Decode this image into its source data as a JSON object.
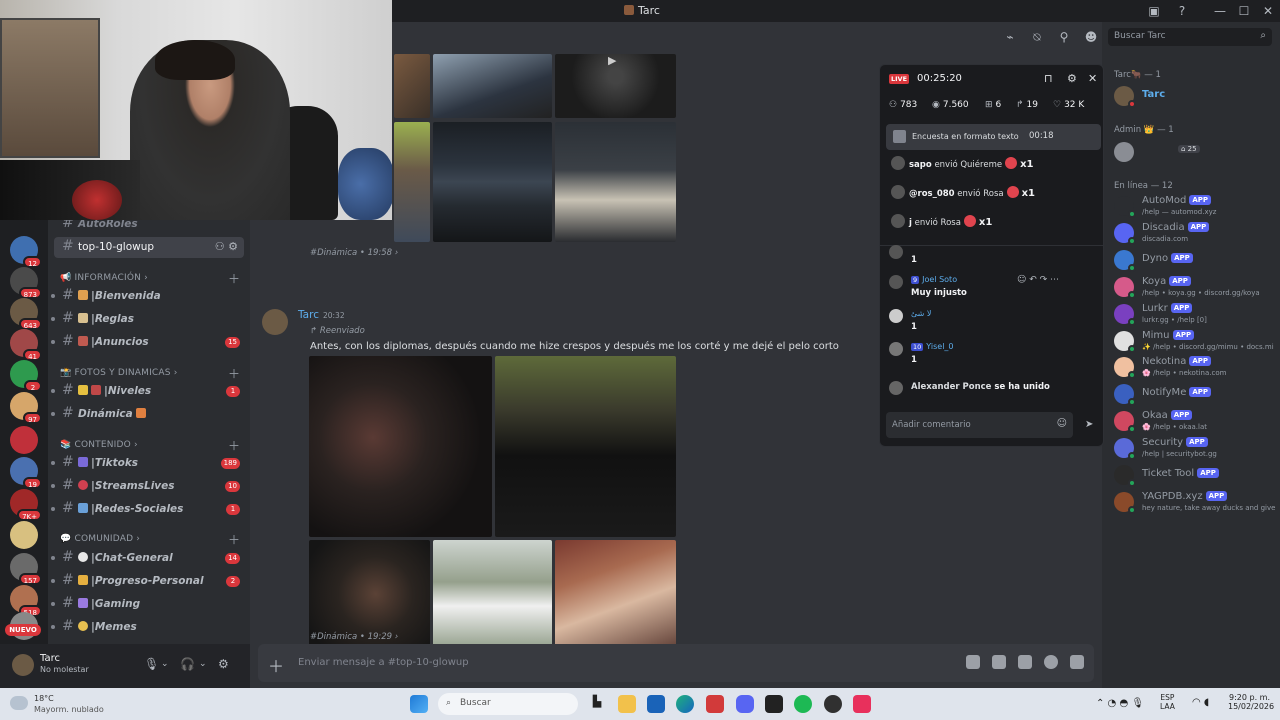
{
  "window": {
    "title": "Tarc"
  },
  "servers": {
    "badges": [
      "12",
      "873",
      "643",
      "41",
      "2",
      "97",
      "",
      "19",
      "7K+",
      "",
      "157",
      "518",
      ""
    ],
    "nuevo": "NUEVO"
  },
  "channels": {
    "autoroles": "AutoRoles",
    "active": "top-10-glowup",
    "cat_info": "INFORMACIÓN",
    "bienvenida": "Bienvenida",
    "reglas": "Reglas",
    "anuncios": "Anuncios",
    "anuncios_count": "15",
    "cat_fotos": "FOTOS Y DINAMICAS",
    "niveles": "Niveles",
    "niveles_count": "1",
    "dinamica": "Dinámica",
    "cat_contenido": "CONTENIDO",
    "tiktoks": "Tiktoks",
    "tiktoks_count": "189",
    "streams": "StreamsLives",
    "streams_count": "10",
    "redes": "Redes-Sociales",
    "redes_count": "1",
    "cat_comunidad": "COMUNIDAD",
    "chat": "Chat-General",
    "chat_count": "14",
    "progreso": "Progreso-Personal",
    "progreso_count": "2",
    "gaming": "Gaming",
    "memes": "Memes"
  },
  "user": {
    "name": "Tarc",
    "status": "No molestar"
  },
  "chat": {
    "meta1": "#Dinámica  •  19:58  ›",
    "author": "Tarc",
    "time": "20:32",
    "forwarded": "↱ Reenviado",
    "text": "Antes, con los diplomas, después cuando me hize crespos y después me los corté y me dejé el pelo corto",
    "meta2": "#Dinámica  •  19:29  ›",
    "composer_placeholder": "Enviar mensaje a #top-10-glowup"
  },
  "search": {
    "placeholder": "Buscar Tarc"
  },
  "members": {
    "owner_group": "Tarc🐂 — 1",
    "owner": "Tarc",
    "admin_group": "Admin 👑 — 1",
    "online_group": "En línea — 12",
    "app_label": "APP",
    "list": [
      {
        "name": "AutoMod",
        "sub": "/help — automod.xyz"
      },
      {
        "name": "Discadia",
        "sub": "discadia.com"
      },
      {
        "name": "Dyno",
        "sub": ""
      },
      {
        "name": "Koya",
        "sub": "/help • koya.gg • discord.gg/koya"
      },
      {
        "name": "Lurkr",
        "sub": "lurkr.gg • /help [0]"
      },
      {
        "name": "Mimu",
        "sub": "✨ /help • discord.gg/mimu • docs.mi"
      },
      {
        "name": "Nekotina",
        "sub": "🌸 /help • nekotina.com"
      },
      {
        "name": "NotifyMe",
        "sub": ""
      },
      {
        "name": "Okaa",
        "sub": "🌸 /help • okaa.lat"
      },
      {
        "name": "Security",
        "sub": "/help | securitybot.gg"
      },
      {
        "name": "Ticket Tool",
        "sub": ""
      },
      {
        "name": "YAGPDB.xyz",
        "sub": "hey nature, take away ducks and give"
      }
    ]
  },
  "live": {
    "badge": "LIVE",
    "timer": "00:25:20",
    "stats": {
      "viewers": "783",
      "views": "7.560",
      "gifts": "6",
      "shares": "19",
      "likes": "32 K"
    },
    "poll": {
      "label": "Encuesta en formato texto",
      "time": "00:18"
    },
    "gifts": [
      {
        "user": "sapo",
        "verb": "envió",
        "item": "Quiéreme",
        "count": "x1"
      },
      {
        "user": "@ros_080",
        "verb": "envió",
        "item": "Rosa",
        "count": "x1"
      },
      {
        "user": "j",
        "verb": "envió",
        "item": "Rosa",
        "count": "x1"
      }
    ],
    "comments": [
      {
        "name": "Joel Soto",
        "level": "9",
        "text": "Muy injusto"
      },
      {
        "name": "لا شئ",
        "level": "",
        "text": "1"
      },
      {
        "name": "Yisel_0",
        "level": "10",
        "text": "1"
      }
    ],
    "first_text": "1",
    "joined_name": "Alexander Ponce",
    "joined_text": "se ha unido",
    "input_placeholder": "Añadir comentario"
  },
  "taskbar": {
    "temp": "18°C",
    "weather": "Mayorm. nublado",
    "search": "Buscar",
    "lang1": "ESP",
    "lang2": "LAA",
    "time": "9:20 p. m.",
    "date": "15/02/2026"
  }
}
